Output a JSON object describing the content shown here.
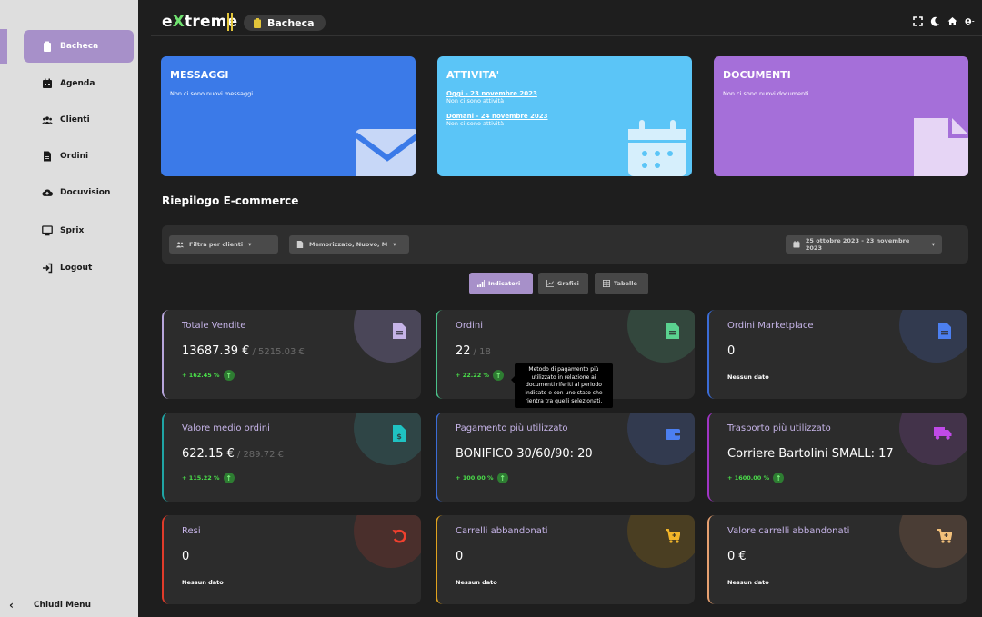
{
  "app": {
    "logo_pre": "e",
    "logo_x": "X",
    "logo_post": "treme",
    "breadcrumb": "Bacheca"
  },
  "colors": {
    "accent": "#a790c9",
    "sidebar_bg": "#dedede",
    "messaggi": "#3b7ae8",
    "attivita": "#5bc5f7",
    "documenti": "#a56fd9",
    "positive": "#4ade4a"
  },
  "sidebar": {
    "items": [
      {
        "label": "Bacheca",
        "icon": "clipboard-icon"
      },
      {
        "label": "Agenda",
        "icon": "calendar-icon"
      },
      {
        "label": "Clienti",
        "icon": "users-icon"
      },
      {
        "label": "Ordini",
        "icon": "file-icon"
      },
      {
        "label": "Docuvision",
        "icon": "cloud-upload-icon"
      },
      {
        "label": "Sprix",
        "icon": "monitor-icon"
      },
      {
        "label": "Logout",
        "icon": "logout-icon"
      }
    ],
    "collapse_label": "Chiudi Menu"
  },
  "hero": {
    "messaggi": {
      "title": "MESSAGGI",
      "text": "Non ci sono nuovi messaggi."
    },
    "attivita": {
      "title": "ATTIVITA'",
      "today_link": "Oggi - 23 novembre 2023",
      "today_text": "Non ci sono attività",
      "tomorrow_link": "Domani - 24 novembre 2023",
      "tomorrow_text": "Non ci sono attività"
    },
    "documenti": {
      "title": "DOCUMENTI",
      "text": "Non ci sono nuovi documenti"
    }
  },
  "section_title": "Riepilogo E-commerce",
  "filters": {
    "clients": "Filtra per clienti",
    "status": "Memorizzato, Nuovo, M",
    "date_range": "25 ottobre 2023 - 23 novembre 2023"
  },
  "view_tabs": {
    "indicators": "Indicatori",
    "charts": "Grafici",
    "tables": "Tabelle"
  },
  "stats": {
    "totale_vendite": {
      "title": "Totale Vendite",
      "value": "13687.39 €",
      "prev": "/ 5215.03 €",
      "delta": "+ 162.45 %"
    },
    "ordini": {
      "title": "Ordini",
      "value": "22",
      "prev": "/ 18",
      "delta": "+ 22.22 %"
    },
    "ordini_marketplace": {
      "title": "Ordini Marketplace",
      "value": "0",
      "nodata": "Nessun dato"
    },
    "valore_medio": {
      "title": "Valore medio ordini",
      "value": "622.15 €",
      "prev": "/ 289.72 €",
      "delta": "+ 115.22 %"
    },
    "pagamento": {
      "title": "Pagamento più utilizzato",
      "value": "BONIFICO 30/60/90: 20",
      "delta": "+ 100.00 %"
    },
    "trasporto": {
      "title": "Trasporto più utilizzato",
      "value": "Corriere Bartolini SMALL: 17",
      "delta": "+ 1600.00 %"
    },
    "resi": {
      "title": "Resi",
      "value": "0",
      "nodata": "Nessun dato"
    },
    "carrelli": {
      "title": "Carrelli abbandonati",
      "value": "0",
      "nodata": "Nessun dato"
    },
    "valore_carrelli": {
      "title": "Valore carrelli abbandonati",
      "value": "0 €",
      "nodata": "Nessun dato"
    }
  },
  "tooltip": "Metodo di pagamento più utilizzato in relazione ai documenti riferiti al periodo indicato e con uno stato che rientra tra quelli selezionati."
}
